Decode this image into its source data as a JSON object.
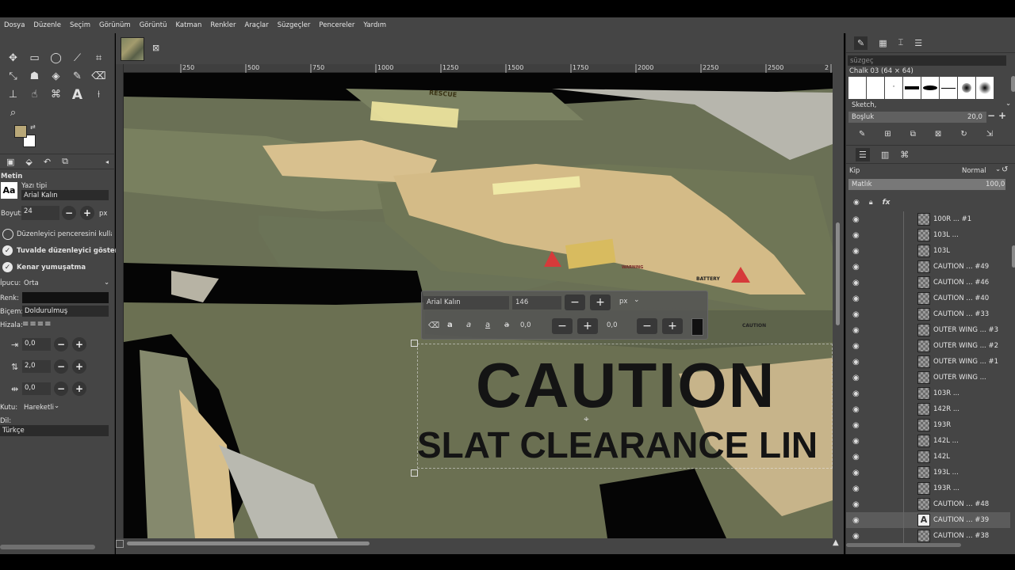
{
  "menu": [
    "Dosya",
    "Düzenle",
    "Seçim",
    "Görünüm",
    "Görüntü",
    "Katman",
    "Renkler",
    "Araçlar",
    "Süzgeçler",
    "Pencereler",
    "Yardım"
  ],
  "tool_options": {
    "title": "Metin",
    "font_label": "Yazı tipi",
    "font_value": "Arial Kalın",
    "size_label": "Boyut:",
    "size_value": "24",
    "size_unit": "px",
    "opt_editor": "Düzenleyici penceresini kullan",
    "opt_canvas_editor": "Tuvalde düzenleyici göster",
    "opt_antialias": "Kenar yumuşatma",
    "hinting_label": "İpucu:",
    "hinting_value": "Orta",
    "color_label": "Renk:",
    "style_label": "Biçem:",
    "style_value": "Doldurulmuş",
    "justify_label": "Hizala:",
    "indent_value": "0,0",
    "line_spacing_value": "2,0",
    "letter_spacing_value": "0,0",
    "box_label": "Kutu:",
    "box_value": "Hareketli",
    "lang_label": "Dil:",
    "lang_value": "Türkçe"
  },
  "ruler_ticks": [
    "250",
    "500",
    "750",
    "1000",
    "1250",
    "1500",
    "1750",
    "2000",
    "2250",
    "2500",
    "2"
  ],
  "text_toolbar": {
    "font": "Arial Kalın",
    "size": "146",
    "unit": "px",
    "baseline": "0,0",
    "kerning": "0,0"
  },
  "canvas_text": {
    "line1": "CAUTION",
    "line2": "SLAT CLEARANCE LIN",
    "rescue": "RESCUE",
    "battery": "BATTERY",
    "caution_small": "CAUTION",
    "warning_small": "WARNING"
  },
  "brushes": {
    "filter_placeholder": "süzgeç",
    "current": "Chalk 03 (64 × 64)",
    "tag": "Sketch,",
    "spacing_label": "Boşluk",
    "spacing_value": "20,0"
  },
  "layers": {
    "mode_label": "Kip",
    "mode_value": "Normal",
    "opacity_label": "Matlık",
    "opacity_value": "100,0",
    "items": [
      "100R ... #1",
      "103L ...",
      "103L",
      "CAUTION ... #49",
      "CAUTION ... #46",
      "CAUTION ... #40",
      "CAUTION ... #33",
      "OUTER WING ... #3",
      "OUTER WING ... #2",
      "OUTER WING ... #1",
      "OUTER WING ...",
      "103R ...",
      "142R ...",
      "193R",
      "142L ...",
      "142L",
      "193L ...",
      "193R ...",
      "CAUTION ... #48",
      "CAUTION ... #39",
      "CAUTION ... #38"
    ],
    "selected_index": 19
  },
  "colors": {
    "fg": "#b9a878",
    "bg": "#ffffff",
    "panel": "#454545",
    "selected_row": "#5b5b5b"
  }
}
